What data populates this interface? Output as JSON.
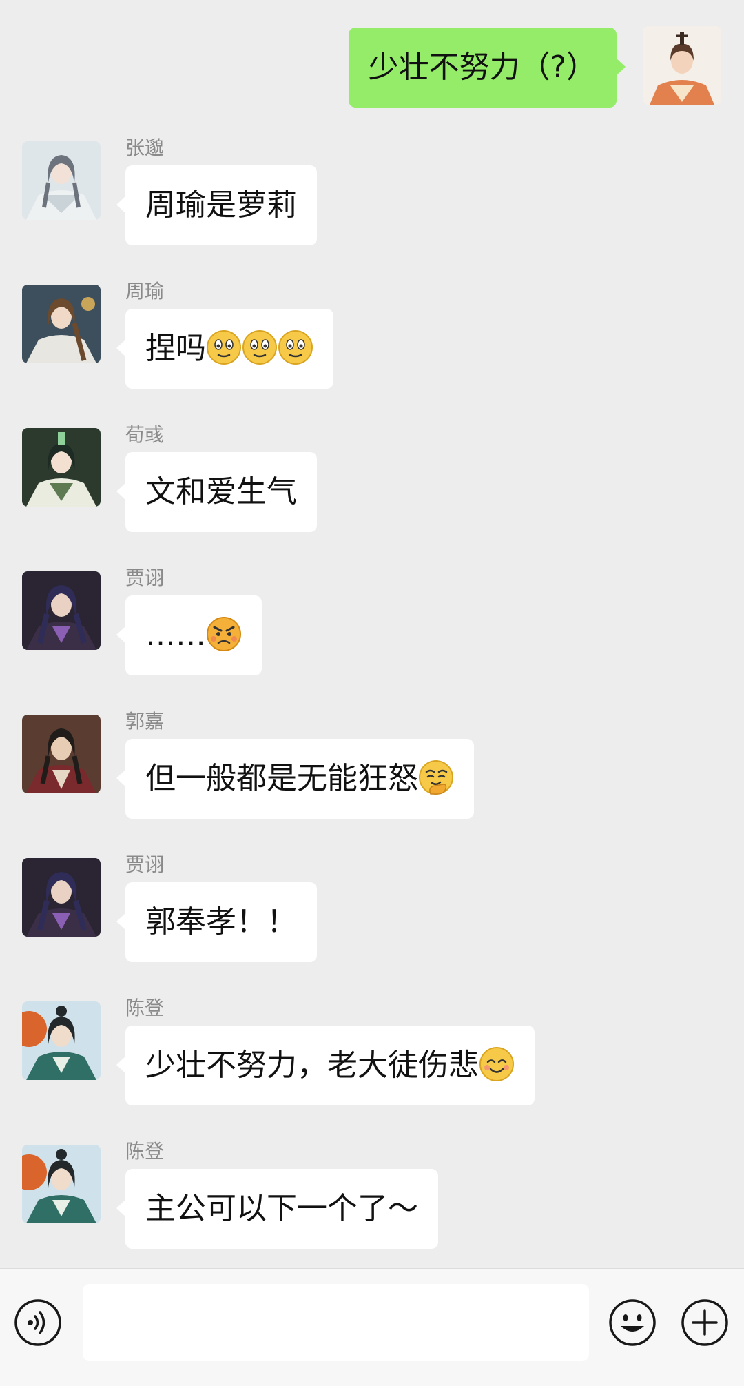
{
  "chat": {
    "messages": [
      {
        "direction": "out",
        "sender": "",
        "text": "少壮不努力（?）",
        "emojis": []
      },
      {
        "direction": "in",
        "sender": "张邈",
        "text": "周瑜是萝莉",
        "emojis": []
      },
      {
        "direction": "in",
        "sender": "周瑜",
        "text": "捏吗",
        "emojis": [
          "slight-smile",
          "slight-smile",
          "slight-smile"
        ]
      },
      {
        "direction": "in",
        "sender": "荀彧",
        "text": "文和爱生气",
        "emojis": []
      },
      {
        "direction": "in",
        "sender": "贾诩",
        "text": "……",
        "emojis": [
          "angry"
        ]
      },
      {
        "direction": "in",
        "sender": "郭嘉",
        "text": "但一般都是无能狂怒",
        "emojis": [
          "smirk-hand"
        ]
      },
      {
        "direction": "in",
        "sender": "贾诩",
        "text": "郭奉孝！！",
        "emojis": []
      },
      {
        "direction": "in",
        "sender": "陈登",
        "text": "少壮不努力，老大徒伤悲",
        "emojis": [
          "blush"
        ]
      },
      {
        "direction": "in",
        "sender": "陈登",
        "text": "主公可以下一个了～",
        "emojis": []
      }
    ]
  },
  "input": {
    "value": "",
    "placeholder": "",
    "voice_icon": "voice-icon",
    "emoji_icon": "emoji-icon",
    "plus_icon": "plus-icon"
  },
  "colors": {
    "background": "#ededed",
    "outgoing_bubble": "#95ec69",
    "incoming_bubble": "#ffffff",
    "sender_name": "#8a8a8a"
  }
}
